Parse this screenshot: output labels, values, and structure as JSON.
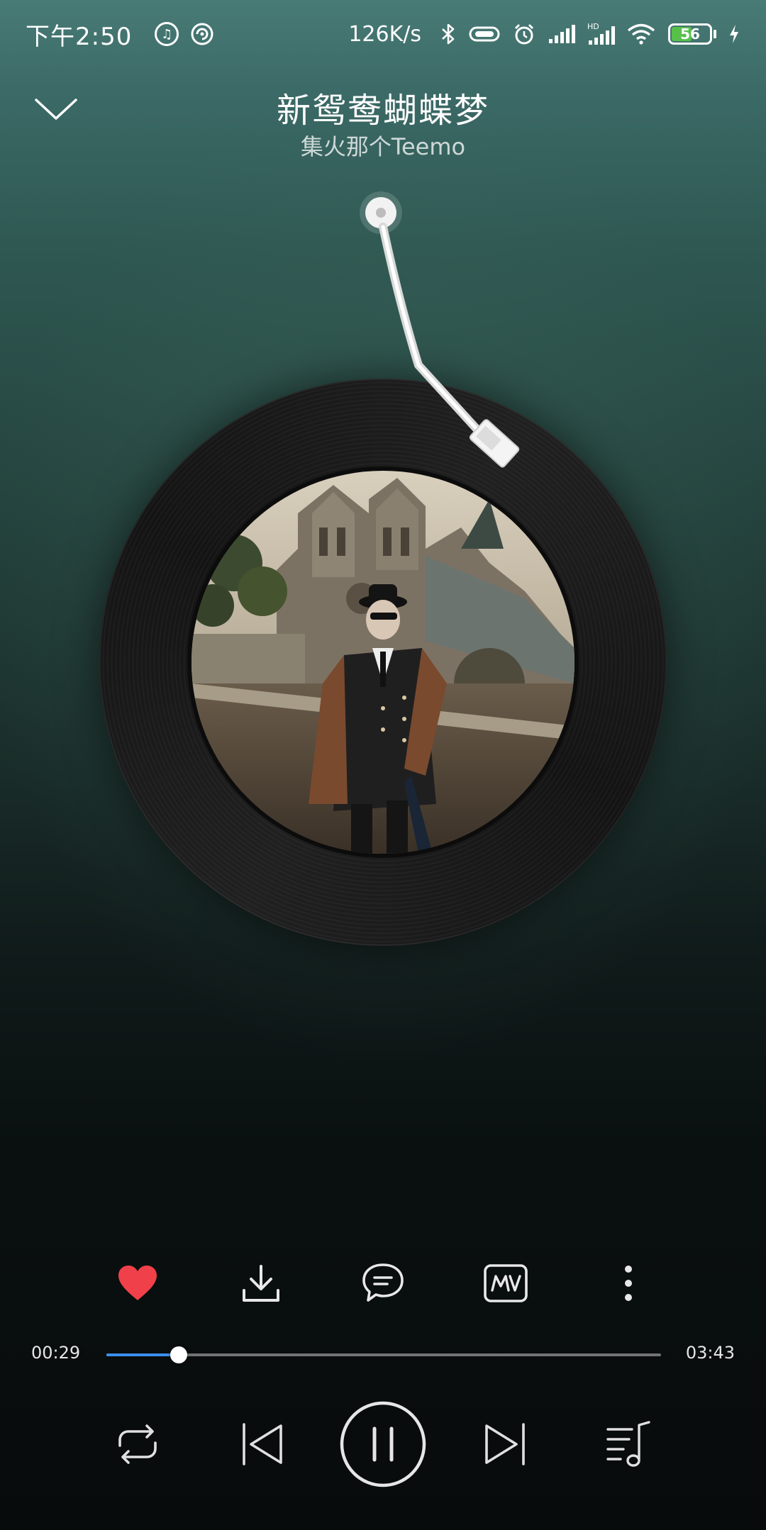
{
  "status_bar": {
    "time": "下午2:50",
    "speed": "126K/s",
    "battery_level": "56",
    "battery_fraction": 0.56,
    "icons": [
      "music-note-icon",
      "sync-icon",
      "bluetooth-icon",
      "vibrate-icon",
      "alarm-icon",
      "signal-icon",
      "hd-signal-icon",
      "wifi-icon",
      "battery-icon",
      "charging-icon"
    ]
  },
  "header": {
    "collapse_icon": "chevron-down-icon",
    "title": "新鸳鸯蝴蝶梦",
    "artist": "集火那个Teemo"
  },
  "actions": [
    {
      "name": "like-button",
      "icon": "heart-icon",
      "active": true,
      "color": "#f0404a"
    },
    {
      "name": "download-button",
      "icon": "download-icon"
    },
    {
      "name": "comment-button",
      "icon": "comment-icon"
    },
    {
      "name": "mv-button",
      "icon": "mv-icon",
      "label": "MV"
    },
    {
      "name": "more-button",
      "icon": "more-vertical-icon"
    }
  ],
  "progress": {
    "current": "00:29",
    "total": "03:43",
    "fraction": 0.13,
    "accent_color": "#3b8ff0"
  },
  "controls": {
    "repeat_icon": "repeat-icon",
    "previous_icon": "skip-previous-icon",
    "play_pause_icon": "pause-icon",
    "next_icon": "skip-next-icon",
    "playlist_icon": "playlist-icon"
  }
}
